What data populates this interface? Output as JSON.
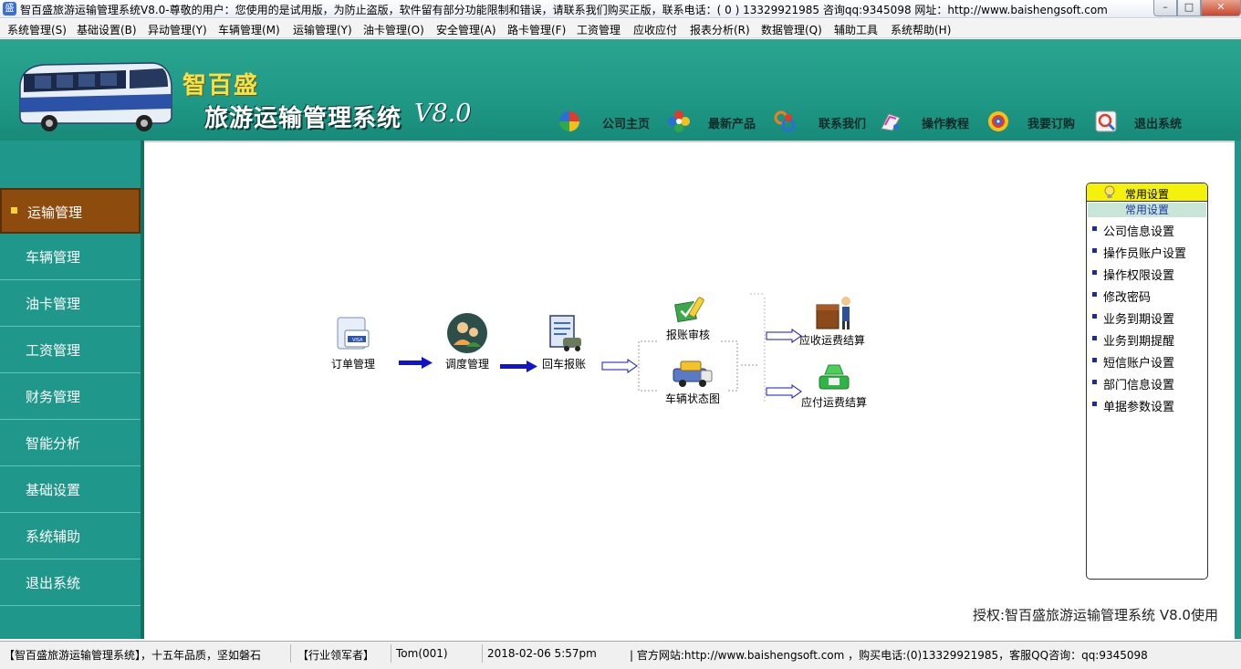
{
  "window": {
    "title": "智百盛旅游运输管理系统V8.0-尊敬的用户：您使用的是试用版，为防止盗版，软件留有部分功能限制和错误，请联系我们购买正版，联系电话：( 0 ) 13329921985  咨询qq:9345098     网址：http://www.baishengsoft.com",
    "min_label": "–",
    "max_label": "□",
    "close_label": "✕"
  },
  "menu": {
    "items": [
      {
        "label": "系统管理(S)"
      },
      {
        "label": "基础设置(B)"
      },
      {
        "label": "异动管理(Y)"
      },
      {
        "label": "车辆管理(M)"
      },
      {
        "label": "运输管理(Y)"
      },
      {
        "label": "油卡管理(O)"
      },
      {
        "label": "安全管理(A)"
      },
      {
        "label": "路卡管理(F)"
      },
      {
        "label": "工资管理"
      },
      {
        "label": "应收应付"
      },
      {
        "label": "报表分析(R)"
      },
      {
        "label": "数据管理(Q)"
      },
      {
        "label": "辅助工具"
      },
      {
        "label": "系统帮助(H)"
      }
    ]
  },
  "header": {
    "brand": "智百盛",
    "product": "旅游运输管理系统",
    "version": "V8.0",
    "nav": [
      {
        "label": "公司主页",
        "icon": "pinwheel-icon"
      },
      {
        "label": "最新产品",
        "icon": "flower-icon"
      },
      {
        "label": "联系我们",
        "icon": "contact-swirl-icon"
      },
      {
        "label": "操作教程",
        "icon": "tutorial-icon"
      },
      {
        "label": "我要订购",
        "icon": "order-icon"
      },
      {
        "label": "退出系统",
        "icon": "exit-icon"
      }
    ]
  },
  "sidebar": {
    "items": [
      {
        "label": "运输管理",
        "active": true
      },
      {
        "label": "车辆管理"
      },
      {
        "label": "油卡管理"
      },
      {
        "label": "工资管理"
      },
      {
        "label": "财务管理"
      },
      {
        "label": "智能分析"
      },
      {
        "label": "基础设置"
      },
      {
        "label": "系统辅助"
      },
      {
        "label": "退出系统"
      }
    ]
  },
  "flow": {
    "nodes": [
      {
        "label": "订单管理"
      },
      {
        "label": "调度管理"
      },
      {
        "label": "回车报账"
      },
      {
        "label": "报账审核"
      },
      {
        "label": "车辆状态图"
      },
      {
        "label": "应收运费结算"
      },
      {
        "label": "应付运费结算"
      }
    ]
  },
  "settings_panel": {
    "title": "常用设置",
    "subtitle": "常用设置",
    "items": [
      {
        "label": "公司信息设置"
      },
      {
        "label": "操作员账户设置"
      },
      {
        "label": "操作权限设置"
      },
      {
        "label": "修改密码"
      },
      {
        "label": "业务到期设置"
      },
      {
        "label": "业务到期提醒"
      },
      {
        "label": "短信账户设置"
      },
      {
        "label": "部门信息设置"
      },
      {
        "label": "单据参数设置"
      }
    ]
  },
  "license": "授权:智百盛旅游运输管理系统 V8.0使用",
  "status": {
    "slogan": "【智百盛旅游运输管理系统】，十五年品质，坚如磐石",
    "leader": "【行业领军者】",
    "user": "Tom(001)",
    "datetime": "2018-02-06 5:57pm",
    "contact": "|  官方网站:http://www.baishengsoft.com ，购买电话:(0)13329921985，客服QQ咨询：qq:9345098"
  },
  "colors": {
    "teal": "#1f978a",
    "active_sidebar": "#8d4c0e",
    "brand_yellow": "#f7e04a",
    "flow_arrow": "#1016c8"
  }
}
